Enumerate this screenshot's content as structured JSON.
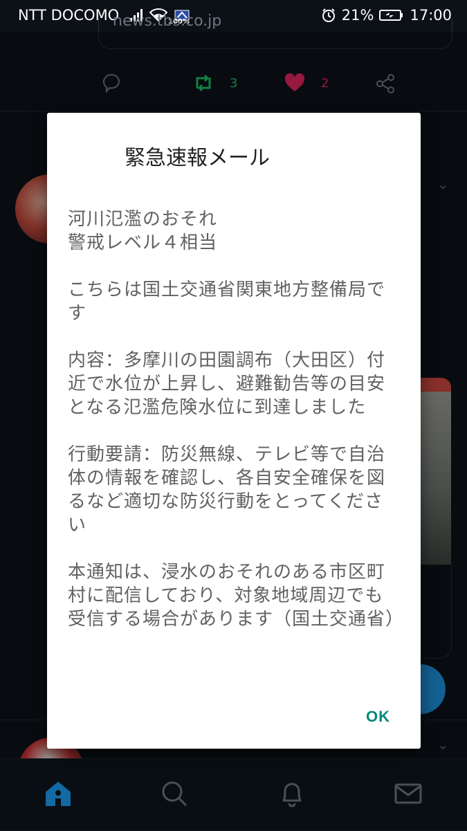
{
  "status_bar": {
    "carrier": "NTT DOCOMO",
    "wifi_badge": "100%",
    "battery": "21%",
    "time": "17:00",
    "icons": [
      "signal-icon",
      "wifi-icon",
      "alarm-icon",
      "battery-charging-icon"
    ]
  },
  "feed": {
    "link_url": "news.tbs.co.jp",
    "retweet_count": "3",
    "like_count": "2",
    "accent_retweet": "#17bf63",
    "accent_like": "#e0245e"
  },
  "dialog": {
    "title": "緊急速報メール",
    "paragraphs": [
      "河川氾濫のおそれ\n警戒レベル４相当",
      "こちらは国土交通省関東地方整備局です",
      "内容：多摩川の田園調布（大田区）付近で水位が上昇し、避難勧告等の目安となる氾濫危険水位に到達しました",
      "行動要請：防災無線、テレビ等で自治体の情報を確認し、各自安全確保を図るなど適切な防災行動をとってください",
      "本通知は、浸水のおそれのある市区町村に配信しており、対象地域周辺でも受信する場合があります（国土交通省）"
    ],
    "ok_label": "OK",
    "ok_color": "#00897b"
  },
  "tab_bar": {
    "active_color": "#1d9bf0",
    "tabs": [
      "home-icon",
      "search-icon",
      "notifications-icon",
      "messages-icon"
    ]
  }
}
